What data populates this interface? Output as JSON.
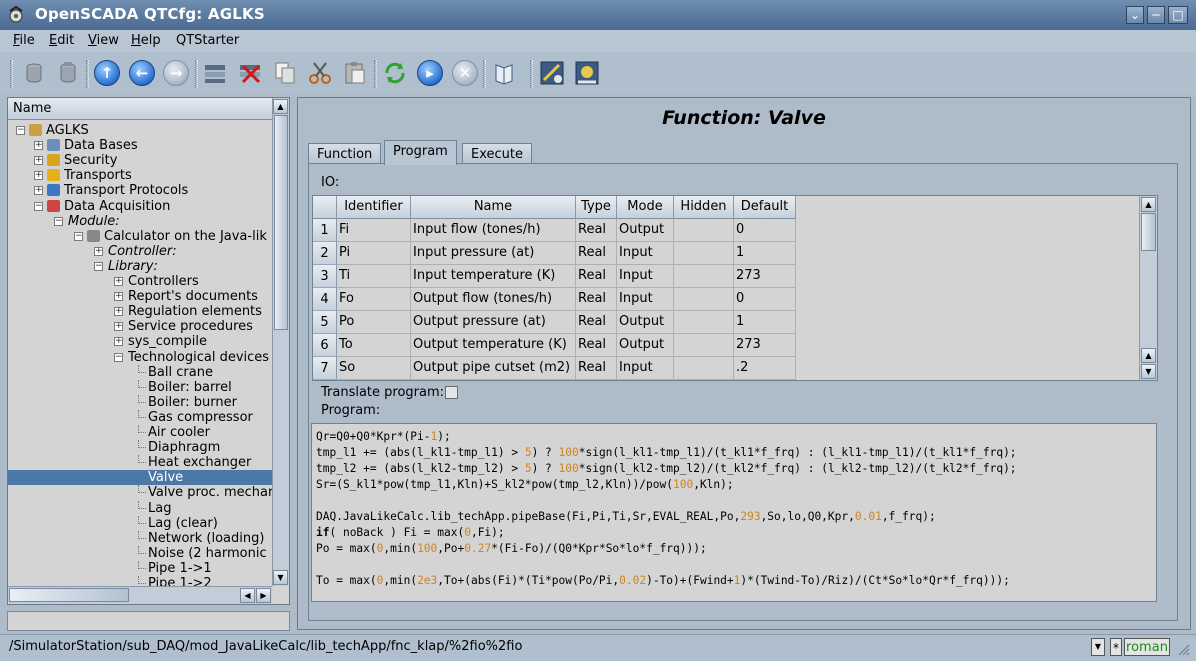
{
  "window": {
    "title": "OpenSCADA QTCfg: AGLKS",
    "controls": [
      "⌄",
      "─",
      "□",
      "✕"
    ]
  },
  "menubar": {
    "items": [
      {
        "label": "File",
        "accel": "F",
        "rest": "ile"
      },
      {
        "label": "Edit",
        "accel": "E",
        "rest": "dit"
      },
      {
        "label": "View",
        "accel": "V",
        "rest": "iew"
      },
      {
        "label": "Help",
        "accel": "H",
        "rest": "elp"
      },
      {
        "label": "QTStarter",
        "accel": "",
        "rest": "QTStarter"
      }
    ]
  },
  "toolbar": {
    "icons": [
      "db-load-icon",
      "db-save-icon",
      "up-icon",
      "back-icon",
      "forward-icon",
      "item-add-icon",
      "item-delete-icon",
      "copy-icon",
      "cut-icon",
      "paste-icon",
      "refresh-icon",
      "start-icon",
      "stop-icon",
      "manual-icon",
      "config-icon",
      "vision-icon"
    ]
  },
  "tree": {
    "header": "Name",
    "nodes": [
      {
        "label": "AGLKS",
        "level": 0,
        "exp": "−",
        "icon": "station"
      },
      {
        "label": "Data Bases",
        "level": 1,
        "exp": "+",
        "icon": "db"
      },
      {
        "label": "Security",
        "level": 1,
        "exp": "+",
        "icon": "security"
      },
      {
        "label": "Transports",
        "level": 1,
        "exp": "+",
        "icon": "transport"
      },
      {
        "label": "Transport Protocols",
        "level": 1,
        "exp": "+",
        "icon": "protocol"
      },
      {
        "label": "Data Acquisition",
        "level": 1,
        "exp": "−",
        "icon": "daq"
      },
      {
        "label": "Module:",
        "level": 2,
        "exp": "−",
        "italic": true
      },
      {
        "label": "Calculator on the Java-lik",
        "level": 3,
        "exp": "−",
        "icon": "calc"
      },
      {
        "label": "Controller:",
        "level": 4,
        "exp": "+",
        "italic": true
      },
      {
        "label": "Library:",
        "level": 4,
        "exp": "−",
        "italic": true
      },
      {
        "label": "Controllers",
        "level": 5,
        "exp": "+"
      },
      {
        "label": "Report's documents",
        "level": 5,
        "exp": "+"
      },
      {
        "label": "Regulation elements",
        "level": 5,
        "exp": "+"
      },
      {
        "label": "Service procedures",
        "level": 5,
        "exp": "+"
      },
      {
        "label": "sys_compile",
        "level": 5,
        "exp": "+"
      },
      {
        "label": "Technological devices",
        "level": 5,
        "exp": "−"
      },
      {
        "label": "Ball crane",
        "level": 6
      },
      {
        "label": "Boiler: barrel",
        "level": 6
      },
      {
        "label": "Boiler: burner",
        "level": 6
      },
      {
        "label": "Gas compressor",
        "level": 6
      },
      {
        "label": "Air cooler",
        "level": 6
      },
      {
        "label": "Diaphragm",
        "level": 6
      },
      {
        "label": "Heat exchanger",
        "level": 6
      },
      {
        "label": "Valve",
        "level": 6,
        "selected": true
      },
      {
        "label": "Valve proc. mechar",
        "level": 6
      },
      {
        "label": "Lag",
        "level": 6
      },
      {
        "label": "Lag (clear)",
        "level": 6
      },
      {
        "label": "Network (loading)",
        "level": 6
      },
      {
        "label": "Noise (2 harmonic",
        "level": 6
      },
      {
        "label": "Pipe 1->1",
        "level": 6
      },
      {
        "label": "Pipe 1->2",
        "level": 6
      }
    ]
  },
  "page": {
    "title": "Function: Valve",
    "tabs": [
      "Function",
      "Program",
      "Execute"
    ],
    "active_tab": 1,
    "io_label": "IO:",
    "io_table": {
      "columns": [
        "Identifier",
        "Name",
        "Type",
        "Mode",
        "Hidden",
        "Default"
      ],
      "rows": [
        {
          "n": "1",
          "cells": [
            "Fi",
            "Input flow (tones/h)",
            "Real",
            "Output",
            "",
            "0"
          ]
        },
        {
          "n": "2",
          "cells": [
            "Pi",
            "Input pressure (at)",
            "Real",
            "Input",
            "",
            "1"
          ]
        },
        {
          "n": "3",
          "cells": [
            "Ti",
            "Input temperature (K)",
            "Real",
            "Input",
            "",
            "273"
          ]
        },
        {
          "n": "4",
          "cells": [
            "Fo",
            "Output flow (tones/h)",
            "Real",
            "Input",
            "",
            "0"
          ]
        },
        {
          "n": "5",
          "cells": [
            "Po",
            "Output pressure (at)",
            "Real",
            "Output",
            "",
            "1"
          ]
        },
        {
          "n": "6",
          "cells": [
            "To",
            "Output temperature (K)",
            "Real",
            "Output",
            "",
            "273"
          ]
        },
        {
          "n": "7",
          "cells": [
            "So",
            "Output pipe cutset (m2)",
            "Real",
            "Input",
            "",
            ".2"
          ]
        }
      ]
    },
    "translate_label": "Translate program:",
    "translate_checked": false,
    "program_label": "Program:",
    "program_lines": [
      "Qr=Q0+Q0*Kpr*(Pi-1);",
      "tmp_l1 += (abs(l_kl1-tmp_l1) > 5) ? 100*sign(l_kl1-tmp_l1)/(t_kl1*f_frq) : (l_kl1-tmp_l1)/(t_kl1*f_frq);",
      "tmp_l2 += (abs(l_kl2-tmp_l2) > 5) ? 100*sign(l_kl2-tmp_l2)/(t_kl2*f_frq) : (l_kl2-tmp_l2)/(t_kl2*f_frq);",
      "Sr=(S_kl1*pow(tmp_l1,Kln)+S_kl2*pow(tmp_l2,Kln))/pow(100,Kln);",
      "",
      "DAQ.JavaLikeCalc.lib_techApp.pipeBase(Fi,Pi,Ti,Sr,EVAL_REAL,Po,293,So,lo,Q0,Kpr,0.01,f_frq);",
      "if( noBack ) Fi = max(0,Fi);",
      "Po = max(0,min(100,Po+0.27*(Fi-Fo)/(Q0*Kpr*So*lo*f_frq)));",
      "",
      "To = max(0,min(2e3,To+(abs(Fi)*(Ti*pow(Po/Pi,0.02)-To)+(Fwind+1)*(Twind-To)/Riz)/(Ct*So*lo*Qr*f_frq)));"
    ]
  },
  "statusbar": {
    "path": "/SimulatorStation/sub_DAQ/mod_JavaLikeCalc/lib_techApp/fnc_klap/%2fio%2fio",
    "star": "*",
    "user": "roman"
  }
}
